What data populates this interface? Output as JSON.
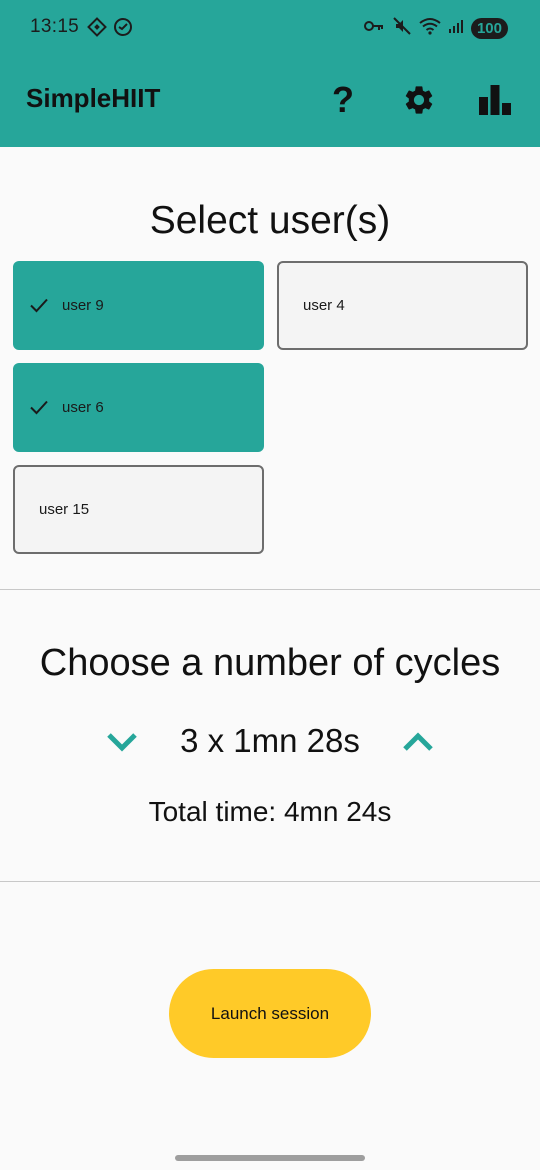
{
  "status_bar": {
    "time": "13:15",
    "battery": "100",
    "left_icons": [
      "vpn-diamond-icon",
      "data-saver-icon"
    ],
    "right_icons": [
      "vpn-key-icon",
      "mute-icon",
      "wifi-icon",
      "signal-icon"
    ]
  },
  "app_bar": {
    "title": "SimpleHIIT",
    "help_label": "?",
    "actions": [
      "help-icon",
      "settings-gear-icon",
      "statistics-bar-chart-icon"
    ]
  },
  "users": {
    "title": "Select user(s)",
    "items": [
      {
        "label": "user 9",
        "selected": true
      },
      {
        "label": "user 4",
        "selected": false
      },
      {
        "label": "user 6",
        "selected": true
      },
      {
        "label": "user 15",
        "selected": false
      }
    ]
  },
  "cycles": {
    "title": "Choose a number of cycles",
    "value": "3 x 1mn 28s",
    "total_time": "Total time: 4mn 24s"
  },
  "launch": {
    "label": "Launch session"
  },
  "colors": {
    "primary": "#26a69a",
    "accent": "#ffca28",
    "background": "#fafafa"
  }
}
